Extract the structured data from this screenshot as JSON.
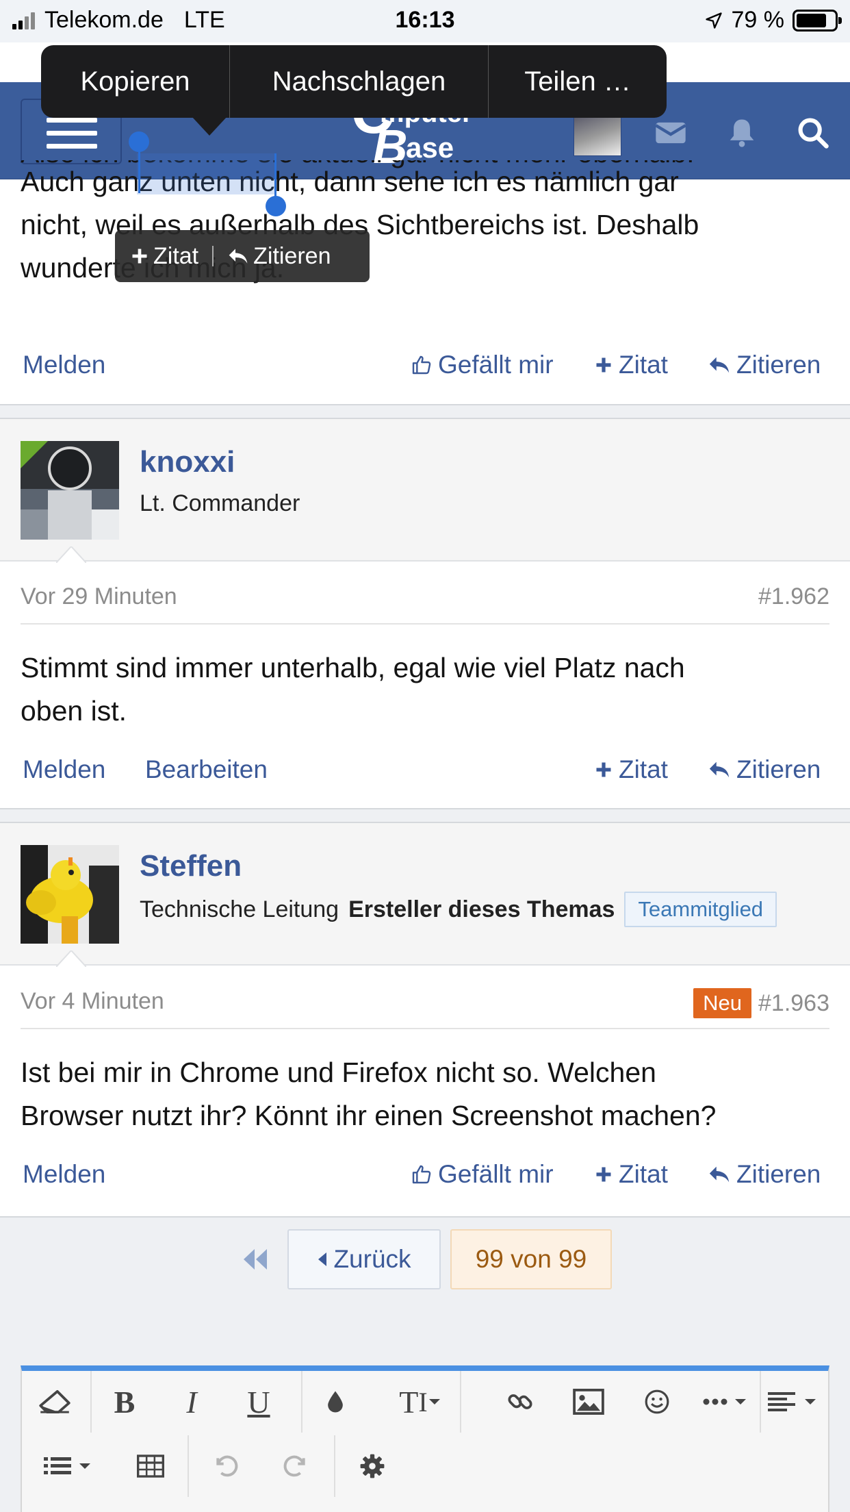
{
  "status_bar": {
    "carrier": "Telekom.de",
    "network": "LTE",
    "time": "16:13",
    "battery": "79 %",
    "battery_level": 0.79
  },
  "context_menu": {
    "items": [
      "Kopieren",
      "Nachschlagen",
      "Teilen …"
    ]
  },
  "header": {
    "logo_text": "ComputerBase"
  },
  "quote_popup": {
    "zitat": "Zitat",
    "zitieren": "Zitieren"
  },
  "posts": [
    {
      "text_lines": [
        "Also ich bekomme sie aktuell gar nicht mehr oberhalb.",
        "Auch ganz unten nicht, dann sehe ich es nämlich gar",
        "nicht, weil es außerhalb des Sichtbereichs ist. Deshalb",
        "wunderte ich mich ja."
      ],
      "actions": {
        "report": "Melden",
        "like": "Gefällt mir",
        "quote": "Zitat",
        "reply": "Zitieren"
      }
    },
    {
      "username": "knoxxi",
      "user_title": "Lt. Commander",
      "time": "Vor 29 Minuten",
      "number": "#1.962",
      "text_lines": [
        "Stimmt sind immer unterhalb, egal wie viel Platz nach",
        "oben ist."
      ],
      "actions": {
        "report": "Melden",
        "edit": "Bearbeiten",
        "quote": "Zitat",
        "reply": "Zitieren"
      }
    },
    {
      "username": "Steffen",
      "user_title": "Technische Leitung",
      "author_label": "Ersteller dieses Themas",
      "badge": "Teammitglied",
      "time": "Vor 4 Minuten",
      "new_badge": "Neu",
      "number": "#1.963",
      "text_lines": [
        "Ist bei mir in Chrome und Firefox nicht so. Welchen",
        "Browser nutzt ihr? Könnt ihr einen Screenshot machen?"
      ],
      "actions": {
        "report": "Melden",
        "like": "Gefällt mir",
        "quote": "Zitat",
        "reply": "Zitieren"
      }
    }
  ],
  "pager": {
    "back": "Zurück",
    "current": "99 von 99"
  },
  "editor": {
    "toolbar_row1": [
      "eraser-icon",
      "bold-icon",
      "italic-icon",
      "underline-icon",
      "color-drop-icon",
      "text-size-icon",
      "link-icon",
      "image-icon",
      "smiley-icon",
      "more-icon",
      "align-icon"
    ],
    "toolbar_row2": [
      "list-icon",
      "table-icon",
      "undo-icon",
      "redo-icon",
      "gear-icon"
    ]
  },
  "colors": {
    "brand": "#3b5d9b",
    "link": "#3b5998",
    "new_badge": "#e0661e",
    "editor_accent": "#4a90e2"
  }
}
